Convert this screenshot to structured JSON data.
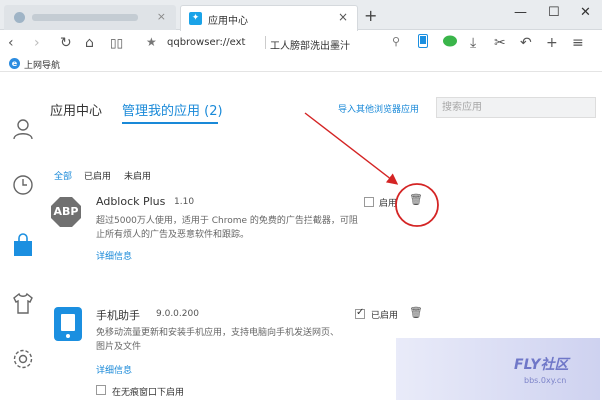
{
  "tabs": {
    "active_title": "应用中心",
    "new_tab_symbol": "+",
    "close_symbol": "×",
    "favicon_glyph": "✦"
  },
  "toolbar": {
    "address_text": "qqbrowser://ext",
    "search_text": "工人膀部洗出墨汁"
  },
  "bookmarks": {
    "items": [
      {
        "label": "上网导航",
        "icon": "e"
      }
    ]
  },
  "header": {
    "tab_app_center": "应用中心",
    "tab_manage": "管理我的应用 (2)",
    "import_link": "导入其他浏览器应用",
    "search_placeholder": "搜索应用"
  },
  "filters": {
    "all": "全部",
    "enabled": "已启用",
    "disabled": "未启用",
    "active": "all"
  },
  "apps": [
    {
      "logo_text": "ABP",
      "name": "Adblock Plus",
      "version": "1.10",
      "desc_line1": "超过5000万人使用，适用于 Chrome 的免费的广告拦截器，可阻",
      "desc_line2": "止所有烦人的广告及恶意软件和跟踪。",
      "detail": "详细信息",
      "enabled": false,
      "enable_label": "启用"
    },
    {
      "name": "手机助手",
      "version": "9.0.0.200",
      "desc_line1": "免移动流量更新和安装手机应用，支持电脑向手机发送网页、",
      "desc_line2": "图片及文件",
      "detail": "详细信息",
      "enabled": true,
      "enable_label": "已启用",
      "incognito_label": "在无痕窗口下启用"
    }
  ],
  "annotation_color": "#d42424",
  "accent_color": "#1989d8",
  "watermark": {
    "main": "FLY社区",
    "sub": "bbs.0xy.cn"
  }
}
